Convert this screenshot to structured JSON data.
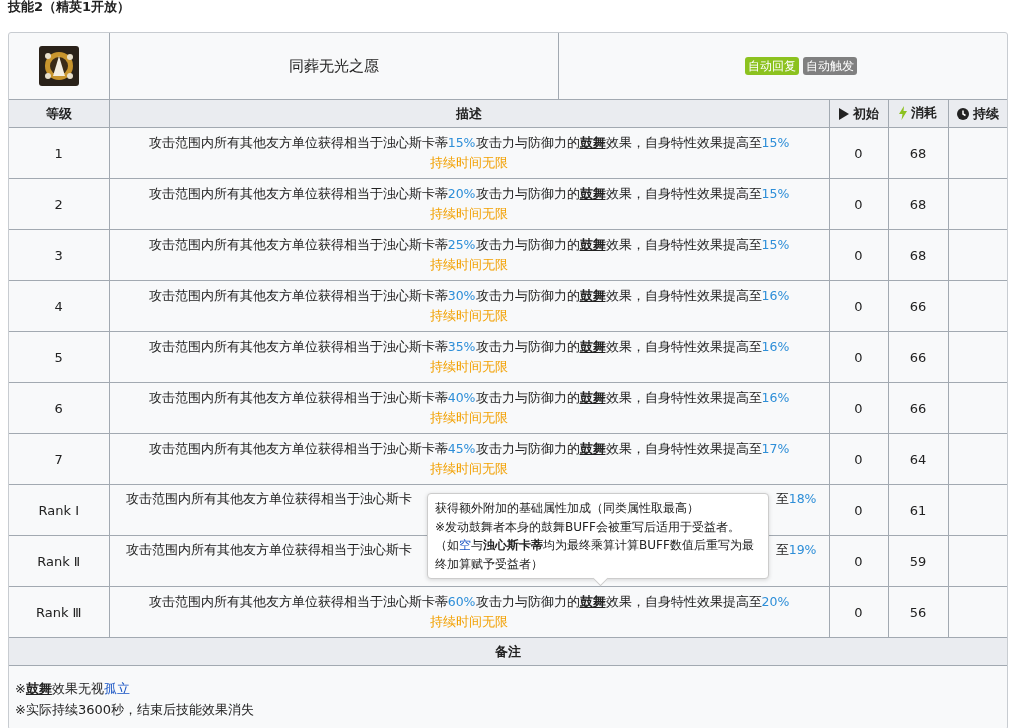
{
  "title": "技能2（精英1开放）",
  "skill": {
    "name": "同葬无光之愿",
    "tags": [
      {
        "label": "自动回复",
        "color": "#8cc21f"
      },
      {
        "label": "自动触发",
        "color": "#808080"
      }
    ]
  },
  "columns": {
    "level": "等级",
    "description": "描述",
    "initial": "初始",
    "cost": "消耗",
    "duration": "持续"
  },
  "rows": [
    {
      "kind": "full",
      "level": "1",
      "description": [
        {
          "kind": "text",
          "text": "攻击范围内所有其他友方单位获得相当于浊心斯卡蒂"
        },
        {
          "kind": "value",
          "text": "15%"
        },
        {
          "kind": "text",
          "text": "攻击力与防御力的"
        },
        {
          "kind": "term",
          "text": "鼓舞"
        },
        {
          "kind": "text",
          "text": "效果，自身特性效果提高至"
        },
        {
          "kind": "value",
          "text": "15%"
        }
      ],
      "duration_note": "持续时间无限",
      "initial": "0",
      "cost": "68"
    },
    {
      "kind": "full",
      "level": "2",
      "description": [
        {
          "kind": "text",
          "text": "攻击范围内所有其他友方单位获得相当于浊心斯卡蒂"
        },
        {
          "kind": "value",
          "text": "20%"
        },
        {
          "kind": "text",
          "text": "攻击力与防御力的"
        },
        {
          "kind": "term",
          "text": "鼓舞"
        },
        {
          "kind": "text",
          "text": "效果，自身特性效果提高至"
        },
        {
          "kind": "value",
          "text": "15%"
        }
      ],
      "duration_note": "持续时间无限",
      "initial": "0",
      "cost": "68"
    },
    {
      "kind": "full",
      "level": "3",
      "description": [
        {
          "kind": "text",
          "text": "攻击范围内所有其他友方单位获得相当于浊心斯卡蒂"
        },
        {
          "kind": "value",
          "text": "25%"
        },
        {
          "kind": "text",
          "text": "攻击力与防御力的"
        },
        {
          "kind": "term",
          "text": "鼓舞"
        },
        {
          "kind": "text",
          "text": "效果，自身特性效果提高至"
        },
        {
          "kind": "value",
          "text": "15%"
        }
      ],
      "duration_note": "持续时间无限",
      "initial": "0",
      "cost": "68"
    },
    {
      "kind": "full",
      "level": "4",
      "description": [
        {
          "kind": "text",
          "text": "攻击范围内所有其他友方单位获得相当于浊心斯卡蒂"
        },
        {
          "kind": "value",
          "text": "30%"
        },
        {
          "kind": "text",
          "text": "攻击力与防御力的"
        },
        {
          "kind": "term",
          "text": "鼓舞"
        },
        {
          "kind": "text",
          "text": "效果，自身特性效果提高至"
        },
        {
          "kind": "value",
          "text": "16%"
        }
      ],
      "duration_note": "持续时间无限",
      "initial": "0",
      "cost": "66"
    },
    {
      "kind": "full",
      "level": "5",
      "description": [
        {
          "kind": "text",
          "text": "攻击范围内所有其他友方单位获得相当于浊心斯卡蒂"
        },
        {
          "kind": "value",
          "text": "35%"
        },
        {
          "kind": "text",
          "text": "攻击力与防御力的"
        },
        {
          "kind": "term",
          "text": "鼓舞"
        },
        {
          "kind": "text",
          "text": "效果，自身特性效果提高至"
        },
        {
          "kind": "value",
          "text": "16%"
        }
      ],
      "duration_note": "持续时间无限",
      "initial": "0",
      "cost": "66"
    },
    {
      "kind": "full",
      "level": "6",
      "description": [
        {
          "kind": "text",
          "text": "攻击范围内所有其他友方单位获得相当于浊心斯卡蒂"
        },
        {
          "kind": "value",
          "text": "40%"
        },
        {
          "kind": "text",
          "text": "攻击力与防御力的"
        },
        {
          "kind": "term",
          "text": "鼓舞"
        },
        {
          "kind": "text",
          "text": "效果，自身特性效果提高至"
        },
        {
          "kind": "value",
          "text": "16%"
        }
      ],
      "duration_note": "持续时间无限",
      "initial": "0",
      "cost": "66"
    },
    {
      "kind": "full",
      "level": "7",
      "description": [
        {
          "kind": "text",
          "text": "攻击范围内所有其他友方单位获得相当于浊心斯卡蒂"
        },
        {
          "kind": "value",
          "text": "45%"
        },
        {
          "kind": "text",
          "text": "攻击力与防御力的"
        },
        {
          "kind": "term",
          "text": "鼓舞"
        },
        {
          "kind": "text",
          "text": "效果，自身特性效果提高至"
        },
        {
          "kind": "value",
          "text": "17%"
        }
      ],
      "duration_note": "持续时间无限",
      "initial": "0",
      "cost": "64"
    },
    {
      "kind": "covered",
      "level": "Rank Ⅰ",
      "description_start": "攻击范围内所有其他友方单位获得相当于浊心斯卡",
      "description_end": [
        {
          "kind": "text",
          "text": "至"
        },
        {
          "kind": "value",
          "text": "18%"
        }
      ],
      "initial": "0",
      "cost": "61"
    },
    {
      "kind": "covered",
      "level": "Rank Ⅱ",
      "description_start": "攻击范围内所有其他友方单位获得相当于浊心斯卡",
      "description_end": [
        {
          "kind": "text",
          "text": "至"
        },
        {
          "kind": "value",
          "text": "19%"
        }
      ],
      "initial": "0",
      "cost": "59"
    },
    {
      "kind": "full",
      "level": "Rank Ⅲ",
      "description": [
        {
          "kind": "text",
          "text": "攻击范围内所有其他友方单位获得相当于浊心斯卡蒂"
        },
        {
          "kind": "value",
          "text": "60%"
        },
        {
          "kind": "text",
          "text": "攻击力与防御力的"
        },
        {
          "kind": "term",
          "text": "鼓舞"
        },
        {
          "kind": "text",
          "text": "效果，自身特性效果提高至"
        },
        {
          "kind": "value",
          "text": "20%"
        }
      ],
      "duration_note": "持续时间无限",
      "initial": "0",
      "cost": "56"
    }
  ],
  "notes_heading": "备注",
  "notes": [
    [
      {
        "kind": "text",
        "text": "※"
      },
      {
        "kind": "term",
        "text": "鼓舞"
      },
      {
        "kind": "text",
        "text": "效果无视"
      },
      {
        "kind": "link",
        "text": "孤立"
      }
    ],
    [
      {
        "kind": "text",
        "text": "※实际持续3600秒，结束后技能效果消失"
      }
    ]
  ],
  "tooltip": [
    {
      "kind": "text",
      "text": "获得额外附加的基础属性加成（同类属性取最高）"
    },
    {
      "kind": "break"
    },
    {
      "kind": "text",
      "text": "※发动鼓舞者本身的鼓舞BUFF会被重写后适用于受益者。（如"
    },
    {
      "kind": "link",
      "text": "空"
    },
    {
      "kind": "text",
      "text": "与"
    },
    {
      "kind": "strong",
      "text": "浊心斯卡蒂"
    },
    {
      "kind": "text",
      "text": "均为最终乘算计算BUFF数值后重写为最终加算赋予受益者）"
    }
  ]
}
